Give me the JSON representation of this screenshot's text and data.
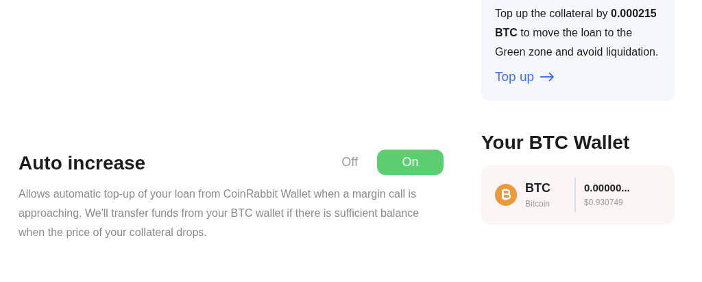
{
  "notice": {
    "text": "Top up the collateral by **0.000215 BTC** to move the loan to the Green zone and avoid liquidation.",
    "link": "Top up"
  },
  "auto_increase": {
    "title": "Auto increase",
    "options": [
      {
        "label": "Off",
        "selected": false
      },
      {
        "label": "On",
        "selected": true
      }
    ],
    "description": "Allows automatic top-up of your loan from CoinRabbit Wallet when a margin call is approaching. We'll transfer funds from your BTC wallet if there is sufficient balance when the price of your collateral drops."
  },
  "wallet": {
    "title": "Your BTC Wallet",
    "symbol": "BTC",
    "name": "Bitcoin",
    "balance": "0.00000...",
    "value": "$0.930749"
  }
}
